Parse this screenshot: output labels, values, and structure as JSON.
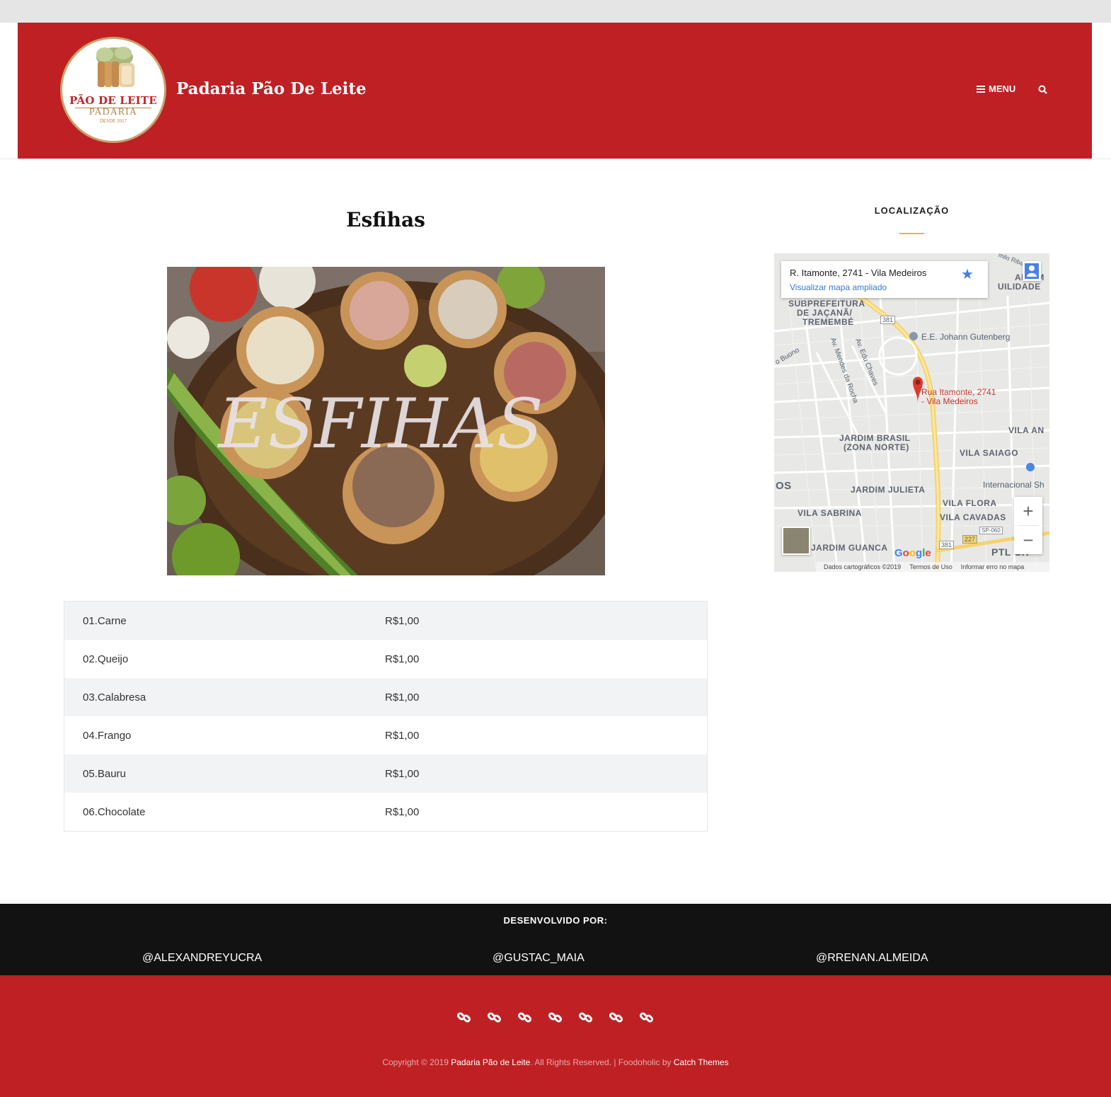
{
  "header": {
    "site_title": "Padaria Pão De Leite",
    "menu_label": "MENU",
    "brand_color": "#be2024",
    "logo": {
      "name": "PÃO DE LEITE",
      "sub": "PADARIA",
      "since": "DESDE 2017"
    }
  },
  "main": {
    "title": "Esfihas",
    "hero_text": "ESFIHAS",
    "menu_items": [
      {
        "item": "01.Carne",
        "price": "R$1,00"
      },
      {
        "item": "02.Queijo",
        "price": "R$1,00"
      },
      {
        "item": "03.Calabresa",
        "price": "R$1,00"
      },
      {
        "item": "04.Frango",
        "price": "R$1,00"
      },
      {
        "item": "05.Bauru",
        "price": "R$1,00"
      },
      {
        "item": "06.Chocolate",
        "price": "R$1,00"
      }
    ]
  },
  "sidebar": {
    "widget_title": "LOCALIZAÇÃO",
    "map": {
      "address": "R. Itamonte, 2741 - Vila Medeiros",
      "view_larger": "Visualizar mapa ampliado",
      "pin_label_1": "Rua Itamonte, 2741",
      "pin_label_2": "- Vila Medeiros",
      "labels": {
        "subpref": "SUBPREFEITURA",
        "jacana": "DE JAÇANÃ/",
        "tremembe": "TREMEMBÉ",
        "jardim_brasil": "JARDIM BRASIL",
        "zona_norte": "(ZONA NORTE)",
        "vila_saiago": "VILA SAIAGO",
        "jardim_julieta": "JARDIM JULIETA",
        "vila_sabrina": "VILA SABRINA",
        "vila_flora": "VILA FLORA",
        "vila_cavadas": "VILA CAVADAS",
        "jardim_guanca": "JARDIM GUANCA",
        "vila_an": "VILA AN",
        "ardim": "ARDIM",
        "uilidade": "UILIDADE",
        "os": "OS",
        "ptl": "PTL CR",
        "school": "E.E. Johann Gutenberg",
        "intl": "Internacional Sh",
        "road_381": "381",
        "road_227": "227",
        "road_sp060": "SP-060",
        "street_mendes": "Av. Mendes da Rocha",
        "street_edu": "Av. Edu Chaves",
        "street_buono": "o Buono",
        "street_ribas": "milo Ribas"
      },
      "google": "Google",
      "map_data": "Dados cartográficos ©2019",
      "terms": "Termos de Uso",
      "report": "Informar erro no mapa"
    }
  },
  "footer": {
    "dev_title": "DESENVOLVIDO POR:",
    "developers": [
      "@ALEXANDREYUCRA",
      "@GUSTAC_MAIA",
      "@RRENAN.ALMEIDA"
    ],
    "social_icons": [
      "link-icon",
      "link-icon",
      "link-icon",
      "link-icon",
      "link-icon",
      "link-icon",
      "link-icon"
    ],
    "copyright_prefix": "Copyright © 2019 ",
    "copyright_site": "Padaria Pão de Leite",
    "copyright_mid": ". All Rights Reserved. | Foodoholic by ",
    "copyright_theme": "Catch Themes"
  }
}
